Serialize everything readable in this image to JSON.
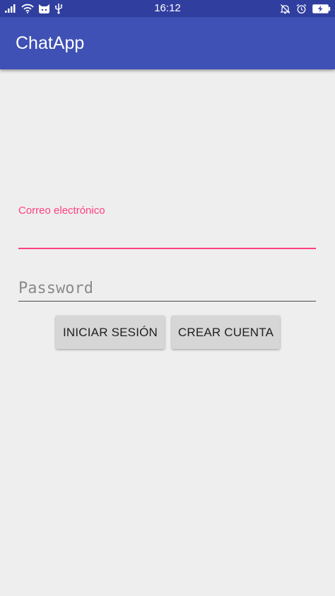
{
  "status_bar": {
    "time": "16:12",
    "icons_left": [
      "signal-icon",
      "wifi-icon",
      "cat-app-icon",
      "usb-icon"
    ],
    "icons_right": [
      "bell-off-icon",
      "alarm-icon",
      "battery-charging-icon"
    ],
    "background_color": "#303f9f"
  },
  "app_bar": {
    "title": "ChatApp",
    "background_color": "#3f51b5"
  },
  "login_form": {
    "email_label": "Correo electrónico",
    "email_value": "",
    "password_placeholder": "Password",
    "password_value": "",
    "accent_color": "#ff4081"
  },
  "actions": {
    "login_label": "INICIAR SESIÓN",
    "create_account_label": "CREAR CUENTA"
  }
}
